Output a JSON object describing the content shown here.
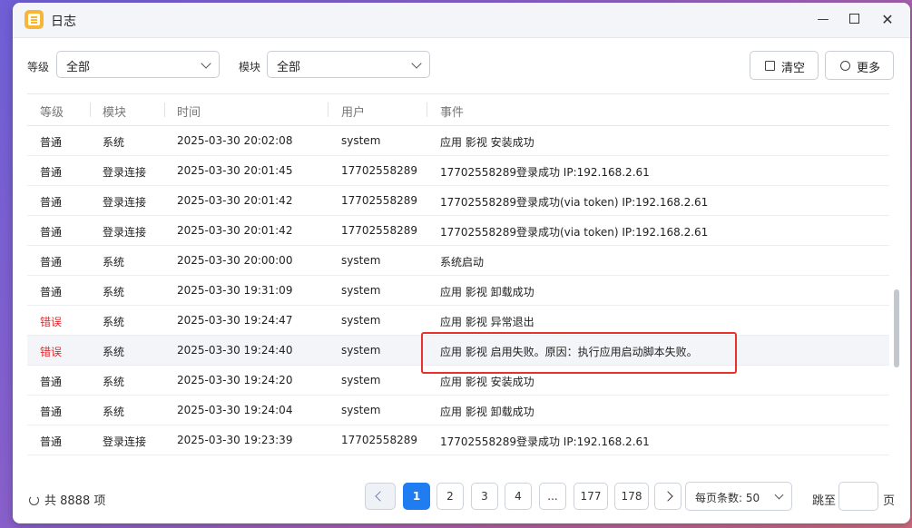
{
  "window": {
    "title": "日志"
  },
  "filters": {
    "level_label": "等级",
    "level_value": "全部",
    "module_label": "模块",
    "module_value": "全部"
  },
  "toolbar": {
    "clear_label": "清空",
    "more_label": "更多"
  },
  "table": {
    "columns": [
      "等级",
      "模块",
      "时间",
      "用户",
      "事件"
    ],
    "rows": [
      {
        "level": "普通",
        "module": "系统",
        "time": "2025-03-30 20:02:08",
        "user": "system",
        "event": "应用 影视 安装成功",
        "error": false
      },
      {
        "level": "普通",
        "module": "登录连接",
        "time": "2025-03-30 20:01:45",
        "user": "17702558289",
        "event": "17702558289登录成功 IP:192.168.2.61",
        "error": false
      },
      {
        "level": "普通",
        "module": "登录连接",
        "time": "2025-03-30 20:01:42",
        "user": "17702558289",
        "event": "17702558289登录成功(via token) IP:192.168.2.61",
        "error": false
      },
      {
        "level": "普通",
        "module": "登录连接",
        "time": "2025-03-30 20:01:42",
        "user": "17702558289",
        "event": "17702558289登录成功(via token) IP:192.168.2.61",
        "error": false
      },
      {
        "level": "普通",
        "module": "系统",
        "time": "2025-03-30 20:00:00",
        "user": "system",
        "event": "系统启动",
        "error": false
      },
      {
        "level": "普通",
        "module": "系统",
        "time": "2025-03-30 19:31:09",
        "user": "system",
        "event": "应用 影视 卸载成功",
        "error": false
      },
      {
        "level": "错误",
        "module": "系统",
        "time": "2025-03-30 19:24:47",
        "user": "system",
        "event": "应用 影视 异常退出",
        "error": true
      },
      {
        "level": "错误",
        "module": "系统",
        "time": "2025-03-30 19:24:40",
        "user": "system",
        "event": "应用 影视 启用失败。原因：执行应用启动脚本失败。",
        "error": true
      },
      {
        "level": "普通",
        "module": "系统",
        "time": "2025-03-30 19:24:20",
        "user": "system",
        "event": "应用 影视 安装成功",
        "error": false
      },
      {
        "level": "普通",
        "module": "系统",
        "time": "2025-03-30 19:24:04",
        "user": "system",
        "event": "应用 影视 卸载成功",
        "error": false
      },
      {
        "level": "普通",
        "module": "登录连接",
        "time": "2025-03-30 19:23:39",
        "user": "17702558289",
        "event": "17702558289登录成功 IP:192.168.2.61",
        "error": false
      }
    ]
  },
  "footer": {
    "total": "共 8888 项",
    "pages": [
      "1",
      "2",
      "3",
      "4",
      "...",
      "177",
      "178"
    ],
    "current_page": "1",
    "per_page": "每页条数: 50",
    "jump_label": "跳至",
    "jump_suffix": "页"
  },
  "colors": {
    "accent": "#1f7cf1",
    "error": "#e02b2b",
    "annotation": "#e8322b"
  },
  "icons": [
    "log-app-icon",
    "minimize-icon",
    "maximize-icon",
    "close-icon",
    "chevron-down-icon",
    "trash-icon",
    "more-icon",
    "refresh-icon",
    "chevron-left-icon",
    "chevron-right-icon"
  ]
}
